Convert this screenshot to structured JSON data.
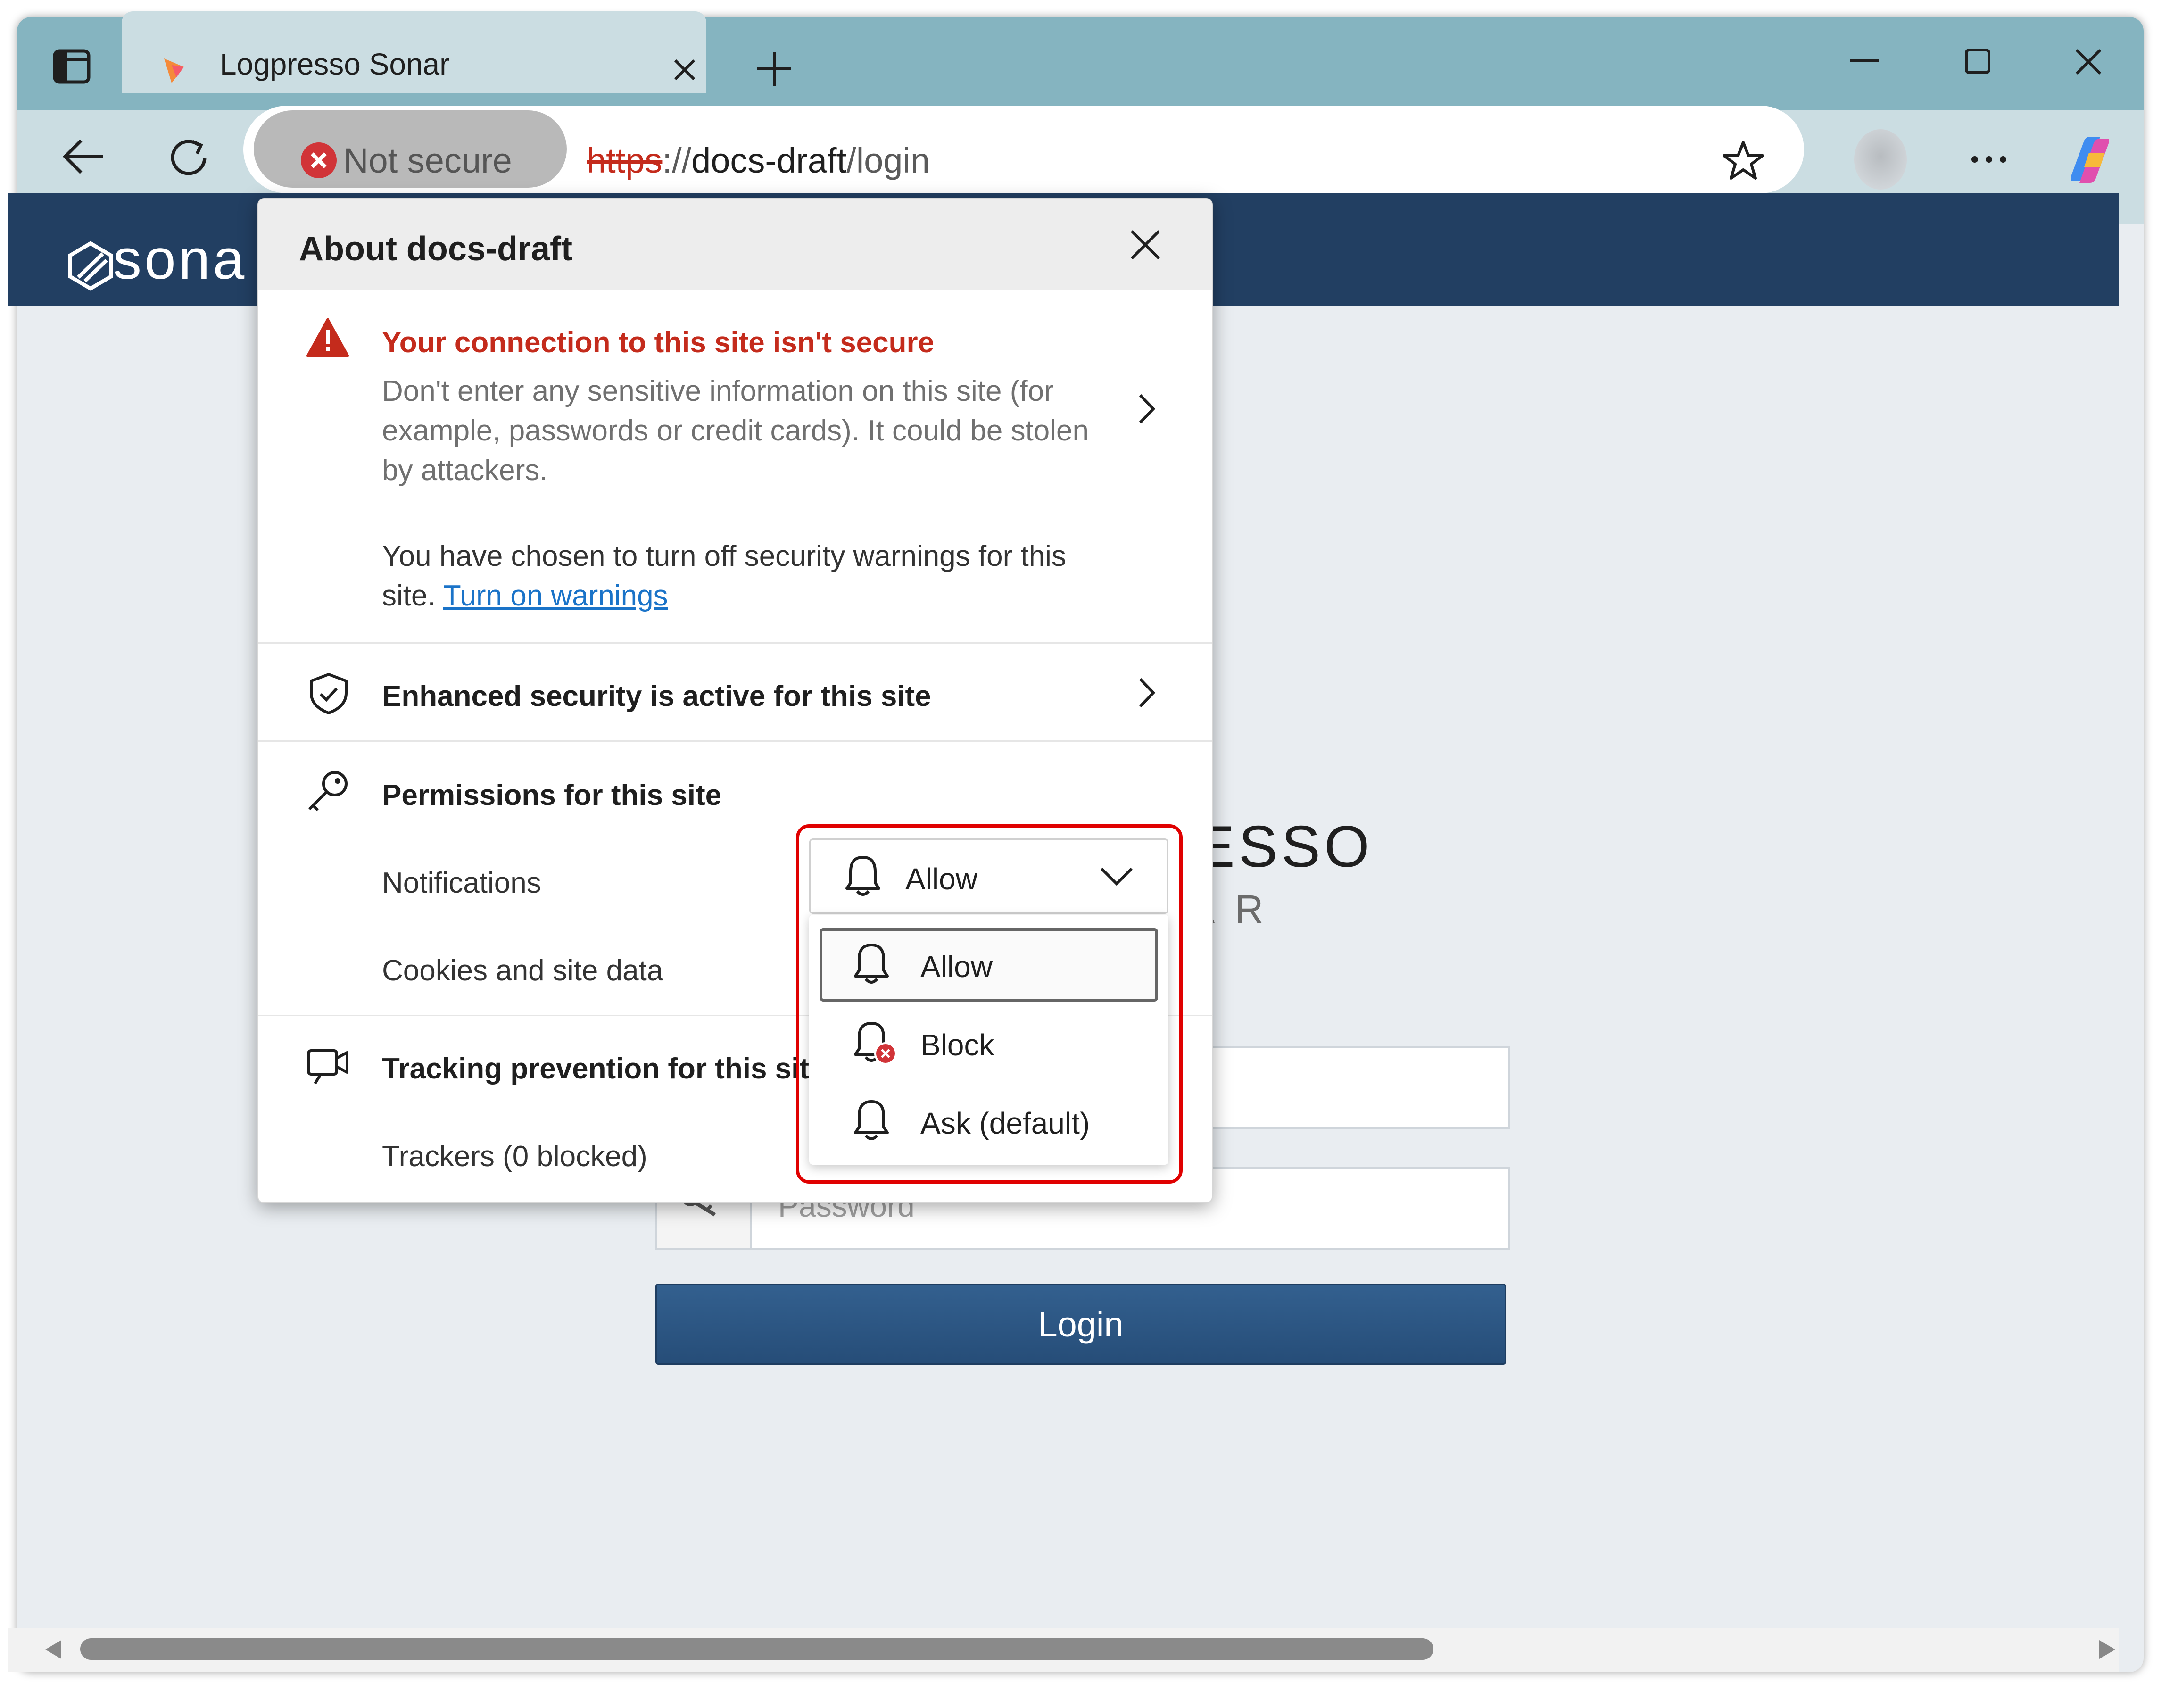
{
  "browser": {
    "tab_title": "Logpresso Sonar",
    "security_label": "Not secure",
    "url_scheme": "https",
    "url_sep": "://",
    "url_host": "docs-draft",
    "url_path": "/login"
  },
  "page": {
    "header_logo_text": "sona",
    "brand_word": "ESSO",
    "brand_sub": "A R",
    "password_placeholder": "Password",
    "login_label": "Login"
  },
  "flyout": {
    "title": "About docs-draft",
    "warning_title": "Your connection to this site isn't secure",
    "warning_body": "Don't enter any sensitive information on this site (for example, passwords or credit cards). It could be stolen by attackers.",
    "warnings_off_text": "You have chosen to turn off security warnings for this site.",
    "turn_on_link": "Turn on warnings",
    "enhanced_security": "Enhanced security is active for this site",
    "permissions_title": "Permissions for this site",
    "notifications_label": "Notifications",
    "cookies_label": "Cookies and site data",
    "tracking_title": "Tracking prevention for this site",
    "trackers_label": "Trackers (0 blocked)"
  },
  "dropdown": {
    "selected": "Allow",
    "options": [
      "Allow",
      "Block",
      "Ask (default)"
    ]
  },
  "colors": {
    "accent_red": "#c42b1c",
    "header_navy": "#223f62",
    "highlight": "#e00000",
    "link_blue": "#1a73c8"
  }
}
